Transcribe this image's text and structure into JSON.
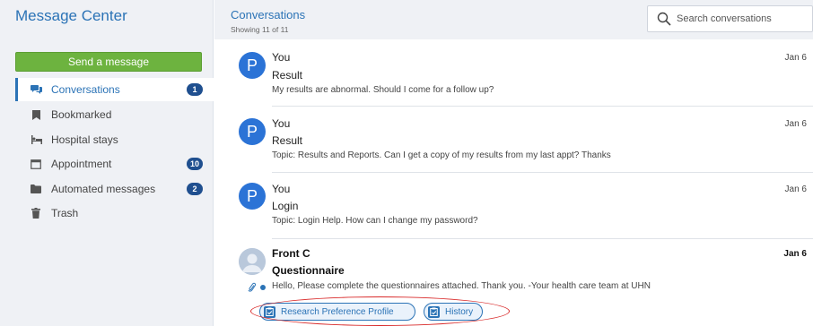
{
  "sidebar": {
    "title": "Message Center",
    "send_button": "Send a message",
    "items": [
      {
        "label": "Conversations",
        "badge": "1",
        "icon": "chat-icon",
        "active": true
      },
      {
        "label": "Bookmarked",
        "badge": "",
        "icon": "bookmark-icon"
      },
      {
        "label": "Hospital stays",
        "badge": "",
        "icon": "bed-icon"
      },
      {
        "label": "Appointment",
        "badge": "10",
        "icon": "calendar-icon"
      },
      {
        "label": "Automated messages",
        "badge": "2",
        "icon": "folder-icon"
      },
      {
        "label": "Trash",
        "badge": "",
        "icon": "trash-icon"
      }
    ]
  },
  "header": {
    "title": "Conversations",
    "subtitle": "Showing 11 of 11",
    "search_placeholder": "Search conversations"
  },
  "messages": [
    {
      "sender": "You",
      "avatar": "P",
      "subject": "Result",
      "preview": "My results are abnormal. Should I come for a follow up?",
      "date": "Jan 6"
    },
    {
      "sender": "You",
      "avatar": "P",
      "subject": "Result",
      "preview": "Topic: Results and Reports.   Can I get a copy of my results from my last appt? Thanks",
      "date": "Jan 6"
    },
    {
      "sender": "You",
      "avatar": "P",
      "subject": "Login",
      "preview": "Topic: Login Help.   How can I change my password?",
      "date": "Jan 6"
    },
    {
      "sender": "Front C",
      "avatar": "",
      "subject": "Questionnaire",
      "preview": "Hello,   Please complete the questionnaires attached. Thank you.   -Your health care team at UHN",
      "date": "Jan 6",
      "unread": true,
      "attachments": [
        "Research Preference Profile",
        "History"
      ]
    }
  ],
  "colors": {
    "accent": "#2b73b6",
    "send_button": "#6db33f",
    "badge": "#1f4f8f",
    "highlight_oval": "#d92b2b"
  }
}
